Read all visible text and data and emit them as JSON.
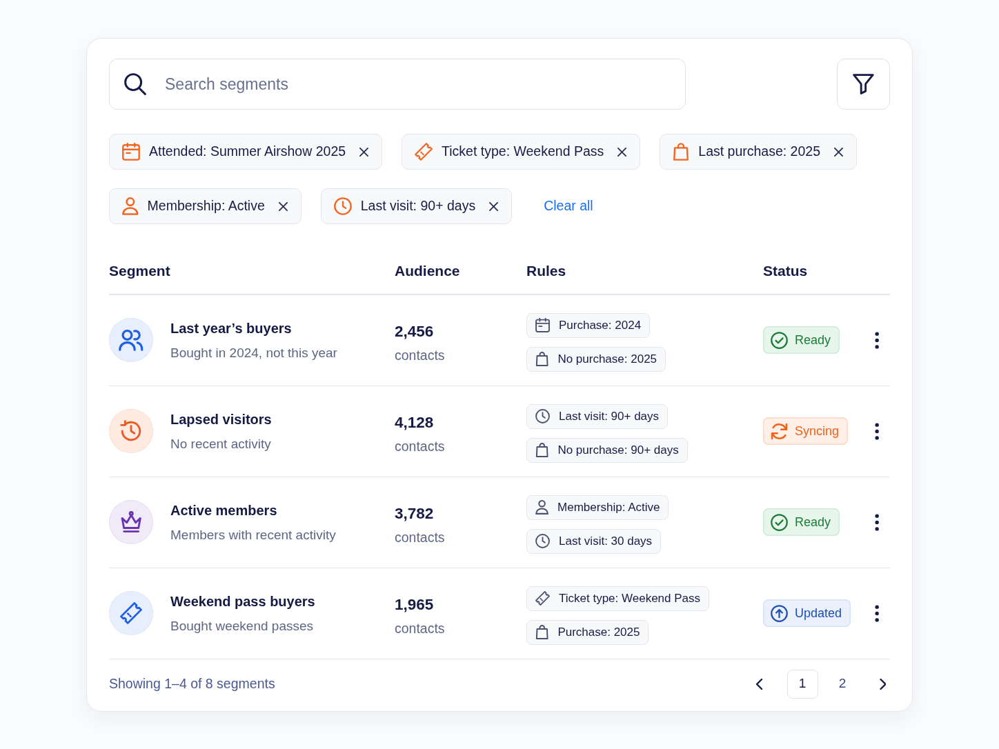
{
  "search": {
    "placeholder": "Search segments"
  },
  "filters": [
    {
      "kind": "event",
      "label": "Attended: Summer Airshow 2025"
    },
    {
      "kind": "ticket",
      "label": "Ticket type: Weekend Pass"
    },
    {
      "kind": "purchase",
      "label": "Last purchase: 2025"
    },
    {
      "kind": "membership",
      "label": "Membership: Active"
    },
    {
      "kind": "visit",
      "label": "Last visit: 90+ days"
    }
  ],
  "clear_all": "Clear all",
  "table": {
    "columns": [
      "Segment",
      "Audience",
      "Rules",
      "Status"
    ],
    "rows": [
      {
        "kind": "buyers",
        "name": "Last year’s buyers",
        "description": "Bought in 2024, not this year",
        "audience": "2,456",
        "audience_unit": "contacts",
        "rules": [
          {
            "kind": "date",
            "label": "Purchase: 2024"
          },
          {
            "kind": "purchase",
            "label": "No purchase: 2025"
          }
        ],
        "status": {
          "kind": "ready",
          "label": "Ready"
        }
      },
      {
        "kind": "lapsed",
        "name": "Lapsed visitors",
        "description": "No recent activity",
        "audience": "4,128",
        "audience_unit": "contacts",
        "rules": [
          {
            "kind": "visit",
            "label": "Last visit: 90+ days"
          },
          {
            "kind": "purchase",
            "label": "No purchase: 90+ days"
          }
        ],
        "status": {
          "kind": "syncing",
          "label": "Syncing"
        }
      },
      {
        "kind": "members",
        "name": "Active members",
        "description": "Members with recent activity",
        "audience": "3,782",
        "audience_unit": "contacts",
        "rules": [
          {
            "kind": "membership",
            "label": "Membership: Active"
          },
          {
            "kind": "visit",
            "label": "Last visit: 30 days"
          }
        ],
        "status": {
          "kind": "ready",
          "label": "Ready"
        }
      },
      {
        "kind": "pass",
        "name": "Weekend pass buyers",
        "description": "Bought weekend passes",
        "audience": "1,965",
        "audience_unit": "contacts",
        "rules": [
          {
            "kind": "ticket",
            "label": "Ticket type: Weekend Pass"
          },
          {
            "kind": "purchase",
            "label": "Purchase: 2025"
          }
        ],
        "status": {
          "kind": "updated",
          "label": "Updated"
        }
      }
    ]
  },
  "footer": {
    "summary": "Showing 1–4 of 8 segments",
    "pages": [
      {
        "label": "1",
        "selected": true
      },
      {
        "label": "2",
        "selected": false
      }
    ]
  }
}
